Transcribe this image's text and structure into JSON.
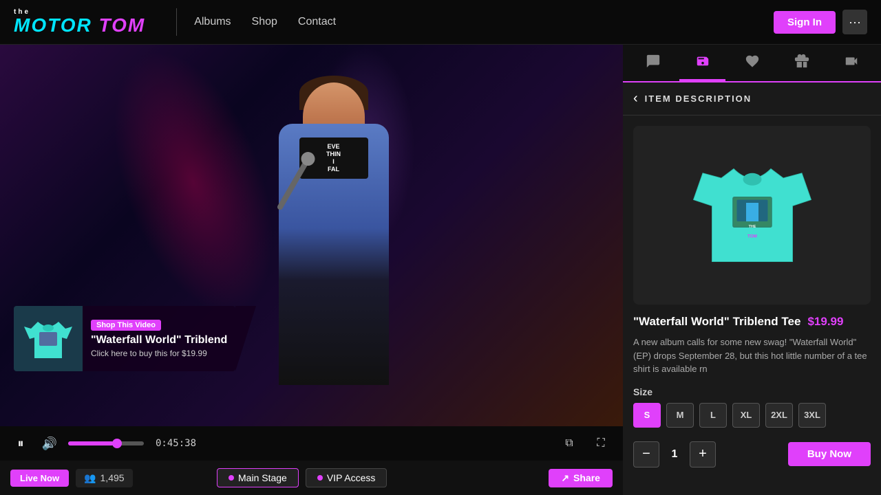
{
  "site": {
    "logo": {
      "the": "the",
      "motor": "MOTOR",
      "tom": "TOM"
    }
  },
  "header": {
    "nav": [
      {
        "label": "Albums"
      },
      {
        "label": "Shop"
      },
      {
        "label": "Contact"
      }
    ],
    "sign_in_label": "Sign In"
  },
  "panel_tabs": [
    {
      "icon": "💬",
      "id": "chat"
    },
    {
      "icon": "🏷️",
      "id": "shop",
      "active": true
    },
    {
      "icon": "❤️",
      "id": "favorites"
    },
    {
      "icon": "🎁",
      "id": "gifts"
    },
    {
      "icon": "▶",
      "id": "video"
    }
  ],
  "item_description": {
    "title": "ITEM DESCRIPTION",
    "back_label": "‹",
    "product_name": "\"Waterfall World\" Triblend Tee",
    "product_price": "$19.99",
    "product_description": "A new album calls for some new swag! \"Waterfall World\" (EP) drops September 28, but this hot little number of a tee shirt is available rn",
    "size_label": "Size",
    "sizes": [
      "S",
      "M",
      "L",
      "XL",
      "2XL",
      "3XL"
    ],
    "selected_size": "S",
    "quantity": "1",
    "quantity_minus": "−",
    "quantity_plus": "+",
    "buy_now_label": "Buy Now"
  },
  "video": {
    "time": "0:45:38",
    "shop_overlay": {
      "tag": "Shop This Video",
      "item_name": "\"Waterfall World\" Triblend",
      "cta": "Click here to buy this for $19.99"
    },
    "controls": {
      "pause_icon": "⏸",
      "volume_icon": "🔊",
      "pip_icon": "⧉",
      "fullscreen_icon": "⛶"
    },
    "bottom_bar": {
      "live_now": "Live Now",
      "viewer_count": "1,495",
      "main_stage_label": "Main Stage",
      "vip_access_label": "VIP Access",
      "share_label": "Share"
    }
  }
}
